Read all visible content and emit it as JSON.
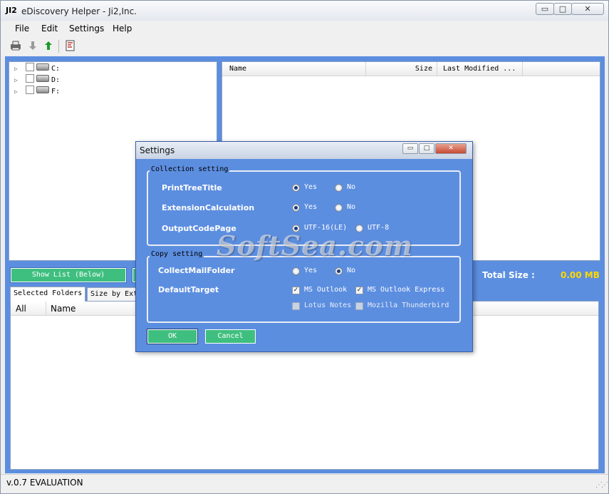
{
  "window": {
    "logo": "JI2",
    "title": "eDiscovery Helper - Ji2,Inc.",
    "min_label": "▭",
    "max_label": "□",
    "close_label": "✕"
  },
  "menu": {
    "file": "File",
    "edit": "Edit",
    "settings": "Settings",
    "help": "Help"
  },
  "toolbar": {
    "icons": [
      "print-icon",
      "move-down-icon",
      "move-up-icon",
      "report-icon"
    ]
  },
  "tree": {
    "drives": [
      {
        "label": "C:"
      },
      {
        "label": "D:"
      },
      {
        "label": "F:"
      }
    ]
  },
  "file_list": {
    "columns": {
      "name": "Name",
      "size": "Size",
      "modified": "Last Modified ..."
    }
  },
  "buttons": {
    "show_list": "Show List (Below)"
  },
  "totals": {
    "label": "Total Size :",
    "value": "0.00 MB"
  },
  "tabs": {
    "selected": "Selected Folders",
    "by_ext": "Size by Ext"
  },
  "bottom_list": {
    "columns": {
      "all": "All",
      "name": "Name"
    }
  },
  "status": {
    "text": "v.0.7 EVALUATION"
  },
  "dialog": {
    "title": "Settings",
    "collection": {
      "legend": "Collection setting",
      "print_tree_title": {
        "label": "PrintTreeTitle",
        "opt1": "Yes",
        "opt2": "No",
        "selected": "Yes"
      },
      "extension_calc": {
        "label": "ExtensionCalculation",
        "opt1": "Yes",
        "opt2": "No",
        "selected": "Yes"
      },
      "output_codepage": {
        "label": "OutputCodePage",
        "opt1": "UTF-16(LE)",
        "opt2": "UTF-8",
        "selected": "UTF-16(LE)"
      }
    },
    "copy": {
      "legend": "Copy setting",
      "collect_mail": {
        "label": "CollectMailFolder",
        "opt1": "Yes",
        "opt2": "No",
        "selected": "No"
      },
      "default_target": {
        "label": "DefaultTarget",
        "ms_outlook": {
          "label": "MS Outlook",
          "checked": true
        },
        "ms_outlook_express": {
          "label": "MS Outlook Express",
          "checked": true
        },
        "lotus_notes": {
          "label": "Lotus Notes",
          "checked": false
        },
        "thunderbird": {
          "label": "Mozilla Thunderbird",
          "checked": false
        }
      }
    },
    "ok_label": "OK",
    "cancel_label": "Cancel"
  },
  "watermark": "SoftSea.com",
  "colors": {
    "client_bg": "#5c8ee0",
    "button_green": "#3fbf7f",
    "total_value": "#ffd800"
  }
}
